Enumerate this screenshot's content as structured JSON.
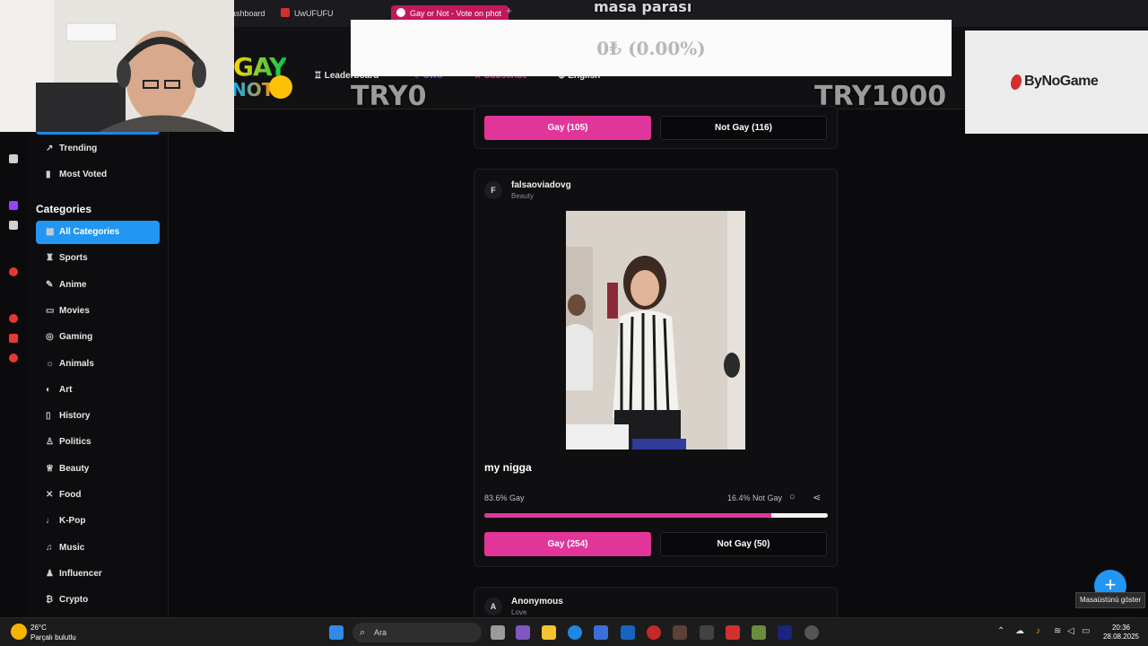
{
  "browser": {
    "tabs": [
      {
        "label": "ashboard"
      },
      {
        "label": "UwUFUFU"
      },
      {
        "label": "Gay or Not - Vote on phot",
        "active": true
      }
    ],
    "new_tab": "+"
  },
  "header": {
    "logo_line1": "GAY",
    "logo_line2": "NOT",
    "nav": [
      {
        "label": "Leaderboard",
        "icon": "trophy-icon"
      },
      {
        "label": "UwU",
        "icon": "heart-icon"
      },
      {
        "label": "Subscribe",
        "icon": "star-icon"
      },
      {
        "label": "English",
        "icon": "globe-icon"
      }
    ]
  },
  "sidebar": {
    "top_items": [
      {
        "label": "Trending",
        "icon": "↗"
      },
      {
        "label": "Most Voted",
        "icon": "▮"
      }
    ],
    "categories_heading": "Categories",
    "categories": [
      {
        "label": "All Categories",
        "icon": "▦",
        "active": true
      },
      {
        "label": "Sports",
        "icon": "♜"
      },
      {
        "label": "Anime",
        "icon": "✎"
      },
      {
        "label": "Movies",
        "icon": "▭"
      },
      {
        "label": "Gaming",
        "icon": "◎"
      },
      {
        "label": "Animals",
        "icon": "☼"
      },
      {
        "label": "Art",
        "icon": "◐"
      },
      {
        "label": "History",
        "icon": "▯"
      },
      {
        "label": "Politics",
        "icon": "♙"
      },
      {
        "label": "Beauty",
        "icon": "♕"
      },
      {
        "label": "Food",
        "icon": "✕"
      },
      {
        "label": "K-Pop",
        "icon": "♩"
      },
      {
        "label": "Music",
        "icon": "♫"
      },
      {
        "label": "Influencer",
        "icon": "♟"
      },
      {
        "label": "Crypto",
        "icon": "₿"
      }
    ]
  },
  "feed": {
    "prev_card": {
      "gay_button": "Gay (105)",
      "not_button": "Not Gay (116)"
    },
    "post": {
      "avatar_letter": "F",
      "username": "falsaoviadovg",
      "category": "Beauty",
      "caption": "my nigga",
      "gay_pct_text": "83.6% Gay",
      "not_pct_text": "16.4% Not Gay",
      "gay_fraction": 0.836,
      "gay_button": "Gay (254)",
      "not_button": "Not Gay (50)"
    },
    "next_card": {
      "avatar_letter": "A",
      "username": "Anonymous",
      "category": "Love"
    }
  },
  "overlays": {
    "donation_title": "masa parası",
    "donation_value": "0₺ (0.00%)",
    "goal_min": "TRY0",
    "goal_max": "TRY1000",
    "sponsor": "ByNoGame"
  },
  "fab": "+",
  "tooltip": "Masaüstünü göster",
  "taskbar": {
    "weather_temp": "26°C",
    "weather_desc": "Parçalı bulutlu",
    "search_placeholder": "Ara",
    "time": "20:36",
    "date": "28.08.2025"
  },
  "colors": {
    "accent_pink": "#e2359a",
    "accent_blue": "#2196f3",
    "background": "#0b0b0d"
  }
}
